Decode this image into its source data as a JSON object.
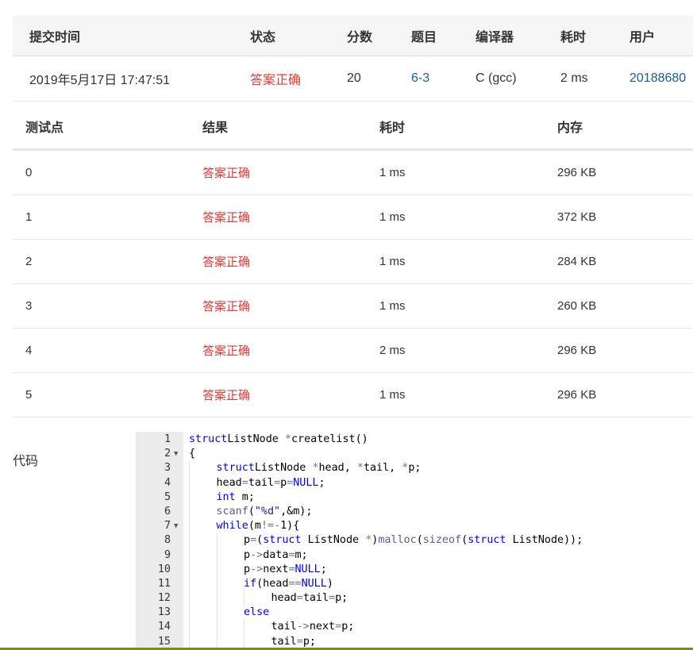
{
  "submission": {
    "headers": [
      "提交时间",
      "状态",
      "分数",
      "题目",
      "编译器",
      "耗时",
      "用户"
    ],
    "row": {
      "time": "2019年5月17日 17:47:51",
      "status": "答案正确",
      "score": "20",
      "problem": "6-3",
      "compiler": "C (gcc)",
      "elapsed": "2 ms",
      "user": "20188680"
    }
  },
  "testpoints": {
    "headers": [
      "测试点",
      "结果",
      "耗时",
      "内存"
    ],
    "rows": [
      {
        "idx": "0",
        "result": "答案正确",
        "time": "1 ms",
        "mem": "296 KB"
      },
      {
        "idx": "1",
        "result": "答案正确",
        "time": "1 ms",
        "mem": "372 KB"
      },
      {
        "idx": "2",
        "result": "答案正确",
        "time": "1 ms",
        "mem": "284 KB"
      },
      {
        "idx": "3",
        "result": "答案正确",
        "time": "1 ms",
        "mem": "260 KB"
      },
      {
        "idx": "4",
        "result": "答案正确",
        "time": "2 ms",
        "mem": "296 KB"
      },
      {
        "idx": "5",
        "result": "答案正确",
        "time": "1 ms",
        "mem": "296 KB"
      }
    ]
  },
  "code": {
    "label": "代码",
    "lines": [
      {
        "n": "1",
        "fold": false,
        "indent": 0,
        "tokens": [
          [
            "kw",
            "struct"
          ],
          [
            "",
            "ListNode"
          ],
          [
            "op",
            " *"
          ],
          [
            "",
            "createlist()"
          ]
        ]
      },
      {
        "n": "2",
        "fold": true,
        "indent": 0,
        "tokens": [
          [
            "",
            "{"
          ]
        ]
      },
      {
        "n": "3",
        "fold": false,
        "indent": 1,
        "tokens": [
          [
            "kw",
            "struct"
          ],
          [
            "",
            "ListNode"
          ],
          [
            "op",
            " *"
          ],
          [
            "",
            "head,"
          ],
          [
            "op",
            " *"
          ],
          [
            "",
            "tail,"
          ],
          [
            "op",
            " *"
          ],
          [
            "",
            "p;"
          ]
        ]
      },
      {
        "n": "4",
        "fold": false,
        "indent": 1,
        "tokens": [
          [
            "",
            "head"
          ],
          [
            "op",
            "="
          ],
          [
            "",
            "tail"
          ],
          [
            "op",
            "="
          ],
          [
            "",
            "p"
          ],
          [
            "op",
            "="
          ],
          [
            "kw",
            "NULL"
          ],
          [
            "",
            ";"
          ]
        ]
      },
      {
        "n": "5",
        "fold": false,
        "indent": 1,
        "tokens": [
          [
            "kw",
            "int"
          ],
          [
            "",
            " m;"
          ]
        ]
      },
      {
        "n": "6",
        "fold": false,
        "indent": 1,
        "tokens": [
          [
            "fn",
            "scanf"
          ],
          [
            "",
            "("
          ],
          [
            "str",
            "\"%d\""
          ],
          [
            "",
            ",&m);"
          ]
        ]
      },
      {
        "n": "7",
        "fold": true,
        "indent": 1,
        "tokens": [
          [
            "kw",
            "while"
          ],
          [
            "",
            "(m"
          ],
          [
            "op",
            "!="
          ],
          [
            "op",
            "-"
          ],
          [
            "",
            "1){"
          ]
        ]
      },
      {
        "n": "8",
        "fold": false,
        "indent": 2,
        "tokens": [
          [
            "",
            "p"
          ],
          [
            "op",
            "="
          ],
          [
            "",
            "("
          ],
          [
            "kw",
            "struct"
          ],
          [
            "",
            " ListNode "
          ],
          [
            "op",
            "*"
          ],
          [
            "",
            ")"
          ],
          [
            "fn",
            "malloc"
          ],
          [
            "",
            "("
          ],
          [
            "fn",
            "sizeof"
          ],
          [
            "",
            "("
          ],
          [
            "kw",
            "struct"
          ],
          [
            "",
            " ListNode));"
          ]
        ]
      },
      {
        "n": "9",
        "fold": false,
        "indent": 2,
        "tokens": [
          [
            "",
            "p"
          ],
          [
            "op",
            "->"
          ],
          [
            "",
            "data"
          ],
          [
            "op",
            "="
          ],
          [
            "",
            "m;"
          ]
        ]
      },
      {
        "n": "10",
        "fold": false,
        "indent": 2,
        "tokens": [
          [
            "",
            "p"
          ],
          [
            "op",
            "->"
          ],
          [
            "",
            "next"
          ],
          [
            "op",
            "="
          ],
          [
            "kw",
            "NULL"
          ],
          [
            "",
            ";"
          ]
        ]
      },
      {
        "n": "11",
        "fold": false,
        "indent": 2,
        "tokens": [
          [
            "kw",
            "if"
          ],
          [
            "",
            "(head"
          ],
          [
            "op",
            "=="
          ],
          [
            "kw",
            "NULL"
          ],
          [
            "",
            ")"
          ]
        ]
      },
      {
        "n": "12",
        "fold": false,
        "indent": 3,
        "tokens": [
          [
            "",
            "head"
          ],
          [
            "op",
            "="
          ],
          [
            "",
            "tail"
          ],
          [
            "op",
            "="
          ],
          [
            "",
            "p;"
          ]
        ]
      },
      {
        "n": "13",
        "fold": false,
        "indent": 2,
        "tokens": [
          [
            "kw",
            "else"
          ]
        ]
      },
      {
        "n": "14",
        "fold": false,
        "indent": 3,
        "tokens": [
          [
            "",
            "tail"
          ],
          [
            "op",
            "->"
          ],
          [
            "",
            "next"
          ],
          [
            "op",
            "="
          ],
          [
            "",
            "p;"
          ]
        ]
      },
      {
        "n": "15",
        "fold": false,
        "indent": 3,
        "tokens": [
          [
            "",
            "tail"
          ],
          [
            "op",
            "="
          ],
          [
            "",
            "p;"
          ]
        ]
      }
    ]
  }
}
